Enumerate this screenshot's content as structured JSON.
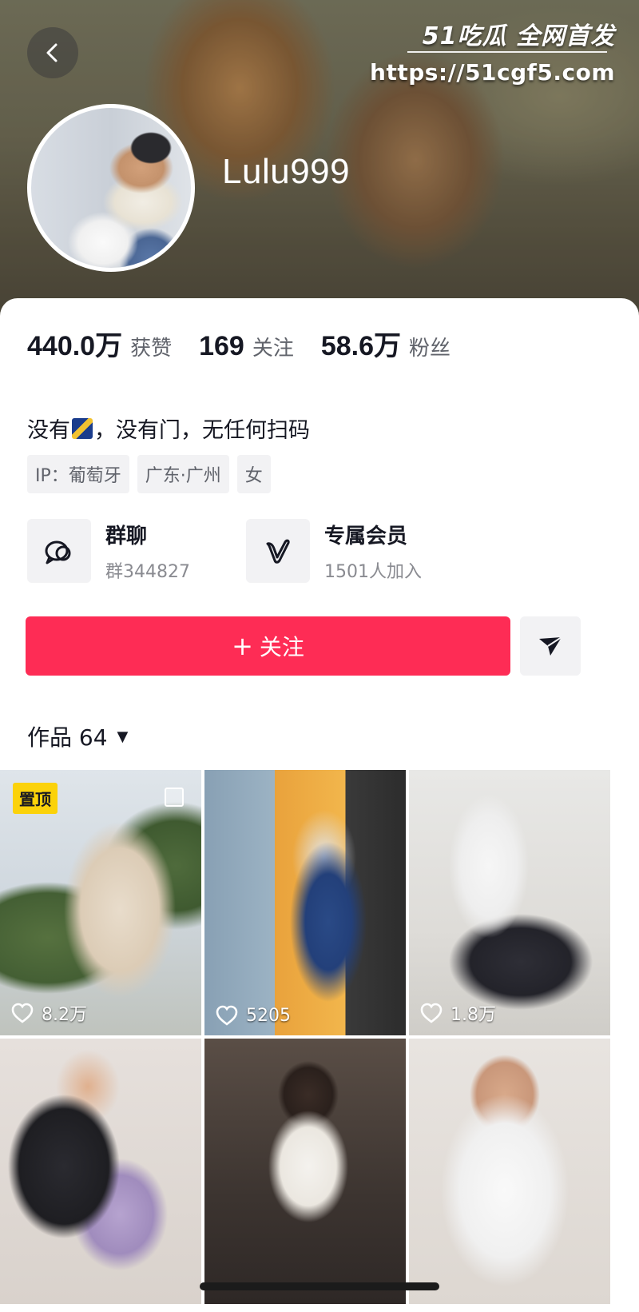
{
  "header": {
    "username": "Lulu999",
    "watermark_line1": "51吃瓜 全网首发",
    "watermark_line2": "https://51cgf5.com"
  },
  "stats": [
    {
      "value": "440.0万",
      "label": "获赞"
    },
    {
      "value": "169",
      "label": "关注"
    },
    {
      "value": "58.6万",
      "label": "粉丝"
    }
  ],
  "bio": {
    "before": "没有",
    "after": "，没有门，无任何扫码"
  },
  "tags": [
    "IP：葡萄牙",
    "广东·广州",
    "女"
  ],
  "features": {
    "group": {
      "title": "群聊",
      "subtitle": "群344827"
    },
    "member": {
      "title": "专属会员",
      "subtitle": "1501人加入"
    }
  },
  "follow_button": {
    "plus": "+",
    "label": "关注"
  },
  "works": {
    "label": "作品 64",
    "caret": "▼"
  },
  "grid": {
    "pin_label": "置顶",
    "tiles": [
      {
        "likes": "8.2万"
      },
      {
        "likes": "5205"
      },
      {
        "likes": "1.8万"
      }
    ]
  },
  "colors": {
    "accent": "#fe2c55",
    "pin": "#fbd20a"
  }
}
